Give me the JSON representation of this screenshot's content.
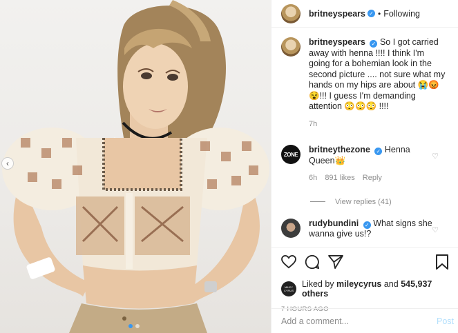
{
  "header": {
    "username": "britneyspears",
    "bullet": "•",
    "follow_status": "Following"
  },
  "caption": {
    "username": "britneyspears",
    "text": "So I got carried away with henna !!!!  I think I'm going for a bohemian look in the second picture .... not sure what my hands on my hips are about 😭😡😵!!! I guess I'm demanding attention 😳😳😳 !!!!",
    "time": "7h"
  },
  "comments": [
    {
      "username": "britneythezone",
      "avatar_text": "ZONE",
      "text": "Henna Queen👑",
      "time": "6h",
      "likes": "891 likes",
      "reply": "Reply",
      "view_replies": "View replies (41)"
    },
    {
      "username": "rudybundini",
      "text": "What signs she wanna give us!?"
    }
  ],
  "liked_by": {
    "prefix": "Liked by",
    "user": "mileycyrus",
    "middle": "and",
    "count": "545,937 others",
    "avatar_text": "MILEY CYRUS"
  },
  "timestamp": "7 HOURS AGO",
  "add_comment": {
    "placeholder": "Add a comment...",
    "post_label": "Post"
  },
  "icons": {
    "like": "heart-icon",
    "comment": "comment-icon",
    "share": "share-icon",
    "save": "bookmark-icon",
    "verified": "verified-badge-icon",
    "comment_like": "small-heart-icon"
  },
  "colors": {
    "accent": "#3897f0",
    "post_disabled": "#b2dffc",
    "secondary_text": "#8e8e8e"
  },
  "carousel": {
    "slides": 2,
    "current": 1
  }
}
